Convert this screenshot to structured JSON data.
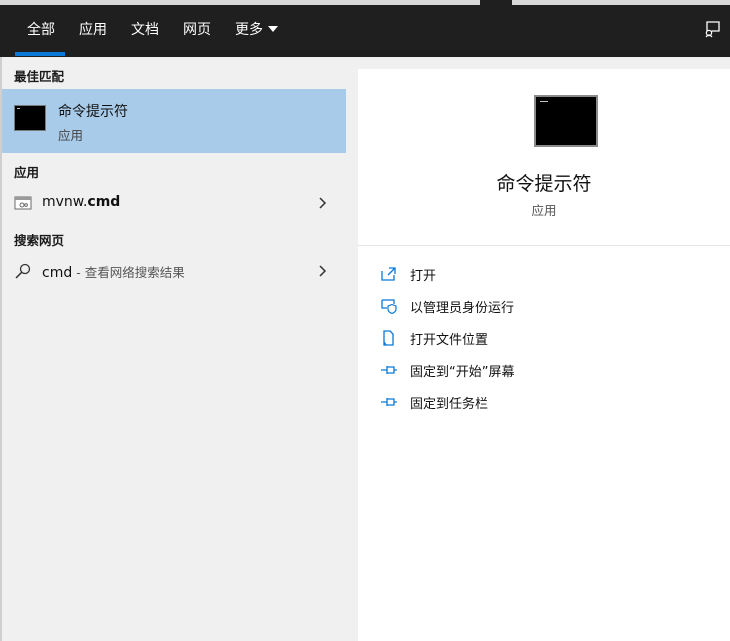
{
  "tabs": [
    {
      "label": "全部",
      "active": true
    },
    {
      "label": "应用"
    },
    {
      "label": "文档"
    },
    {
      "label": "网页"
    },
    {
      "label": "更多"
    }
  ],
  "icons": {
    "feedback": "feedback-icon",
    "dropdown": "chevron-down-icon"
  },
  "colors": {
    "accent": "#0a78d7",
    "selection": "#a8cbea",
    "topbar": "#1f1f1f",
    "icon_blue": "#0a78d7"
  },
  "results": {
    "best_match_header": "最佳匹配",
    "best_match": {
      "title": "命令提示符",
      "subtitle": "应用"
    },
    "apps_header": "应用",
    "app_item": {
      "label_plain": "mvnw.",
      "label_bold": "cmd"
    },
    "web_header": "搜索网页",
    "web_item": {
      "query": "cmd",
      "hint": " - 查看网络搜索结果"
    }
  },
  "details": {
    "title": "命令提示符",
    "subtitle": "应用",
    "actions": [
      {
        "label": "打开",
        "icon": "open-icon"
      },
      {
        "label": "以管理员身份运行",
        "icon": "admin-shield-icon"
      },
      {
        "label": "打开文件位置",
        "icon": "file-location-icon"
      },
      {
        "label": "固定到“开始”屏幕",
        "icon": "pin-icon"
      },
      {
        "label": "固定到任务栏",
        "icon": "pin-icon"
      }
    ]
  }
}
